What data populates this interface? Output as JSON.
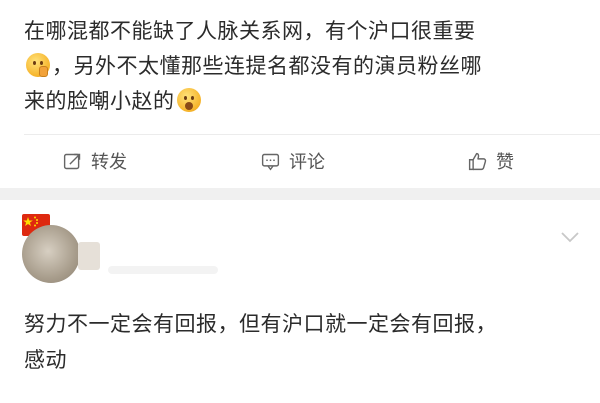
{
  "post": {
    "line1": "在哪混都不能缺了人脉关系网，有个沪口很重要",
    "line2": "，另外不太懂那些连提名都没有的演员粉丝哪",
    "line3": "来的脸嘲小赵的",
    "emoji1": "shush-face-emoji",
    "emoji2": "astonished-face-emoji"
  },
  "actions": {
    "repost_label": "转发",
    "comment_label": "评论",
    "like_label": "赞"
  },
  "comment": {
    "text_line1": "努力不一定会有回报，但有沪口就一定会有回报，",
    "text_line2": "感动",
    "badge": "china-flag-icon"
  },
  "colors": {
    "text": "#2b2b2b",
    "muted": "#555555",
    "divider": "#f0f0f0"
  }
}
